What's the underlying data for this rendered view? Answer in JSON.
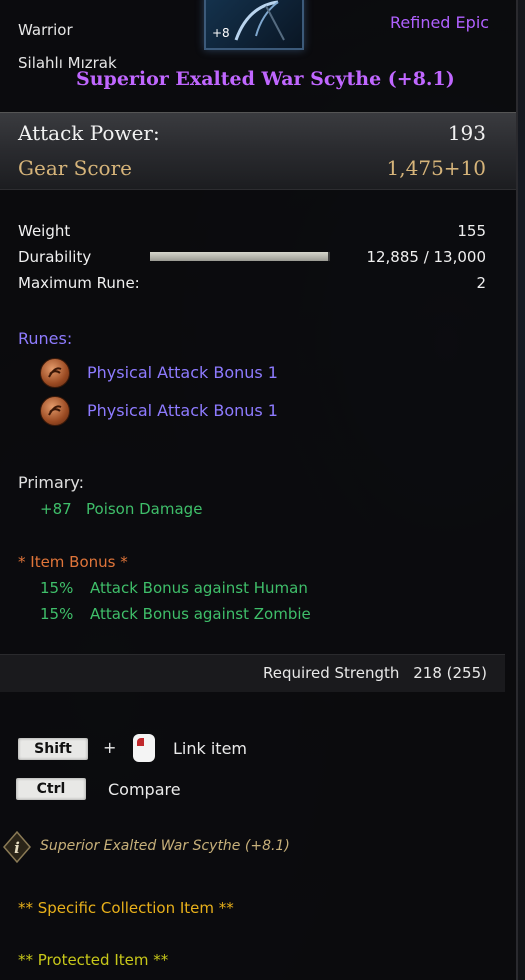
{
  "item": {
    "enhance_badge": "+8",
    "class": "Warrior",
    "weapon_type": "Silahlı Mızrak",
    "grade": "Refined Epic",
    "name": "Superior Exalted War Scythe (+8.1)"
  },
  "main_stats": {
    "attack_power_label": "Attack Power:",
    "attack_power_value": "193",
    "gear_score_label": "Gear Score",
    "gear_score_value": "1,475+10"
  },
  "details": {
    "weight_label": "Weight",
    "weight_value": "155",
    "durability_label": "Durability",
    "durability_value": "12,885 / 13,000",
    "durability_fraction": 0.991,
    "max_rune_label": "Maximum Rune:",
    "max_rune_value": "2"
  },
  "runes": {
    "header": "Runes:",
    "items": [
      {
        "name": "Physical Attack Bonus 1",
        "icon": "rune-icon"
      },
      {
        "name": "Physical Attack Bonus 1",
        "icon": "rune-icon"
      }
    ]
  },
  "primary": {
    "header": "Primary:",
    "value": "+87",
    "stat": "Poison Damage"
  },
  "item_bonus": {
    "header": "*  Item Bonus *",
    "entries": [
      {
        "value": "15%",
        "text": "Attack Bonus against Human"
      },
      {
        "value": "15%",
        "text": "Attack Bonus against Zombie"
      }
    ]
  },
  "requirement": {
    "label": "Required Strength",
    "value": "218 (255)"
  },
  "hints": {
    "shift_key": "Shift",
    "plus": "+",
    "link_label": "Link item",
    "ctrl_key": "Ctrl",
    "compare_label": "Compare"
  },
  "footer": {
    "item_name_italic": "Superior Exalted War Scythe (+8.1)",
    "collection": "** Specific Collection Item **",
    "protected": "** Protected Item **"
  },
  "colors": {
    "grade": "#b061ff",
    "rune_text": "#8e7bff",
    "bonus_green": "#3fbf6a",
    "gear_score": "#d6b47a",
    "collection_yellow": "#e8b01a"
  }
}
